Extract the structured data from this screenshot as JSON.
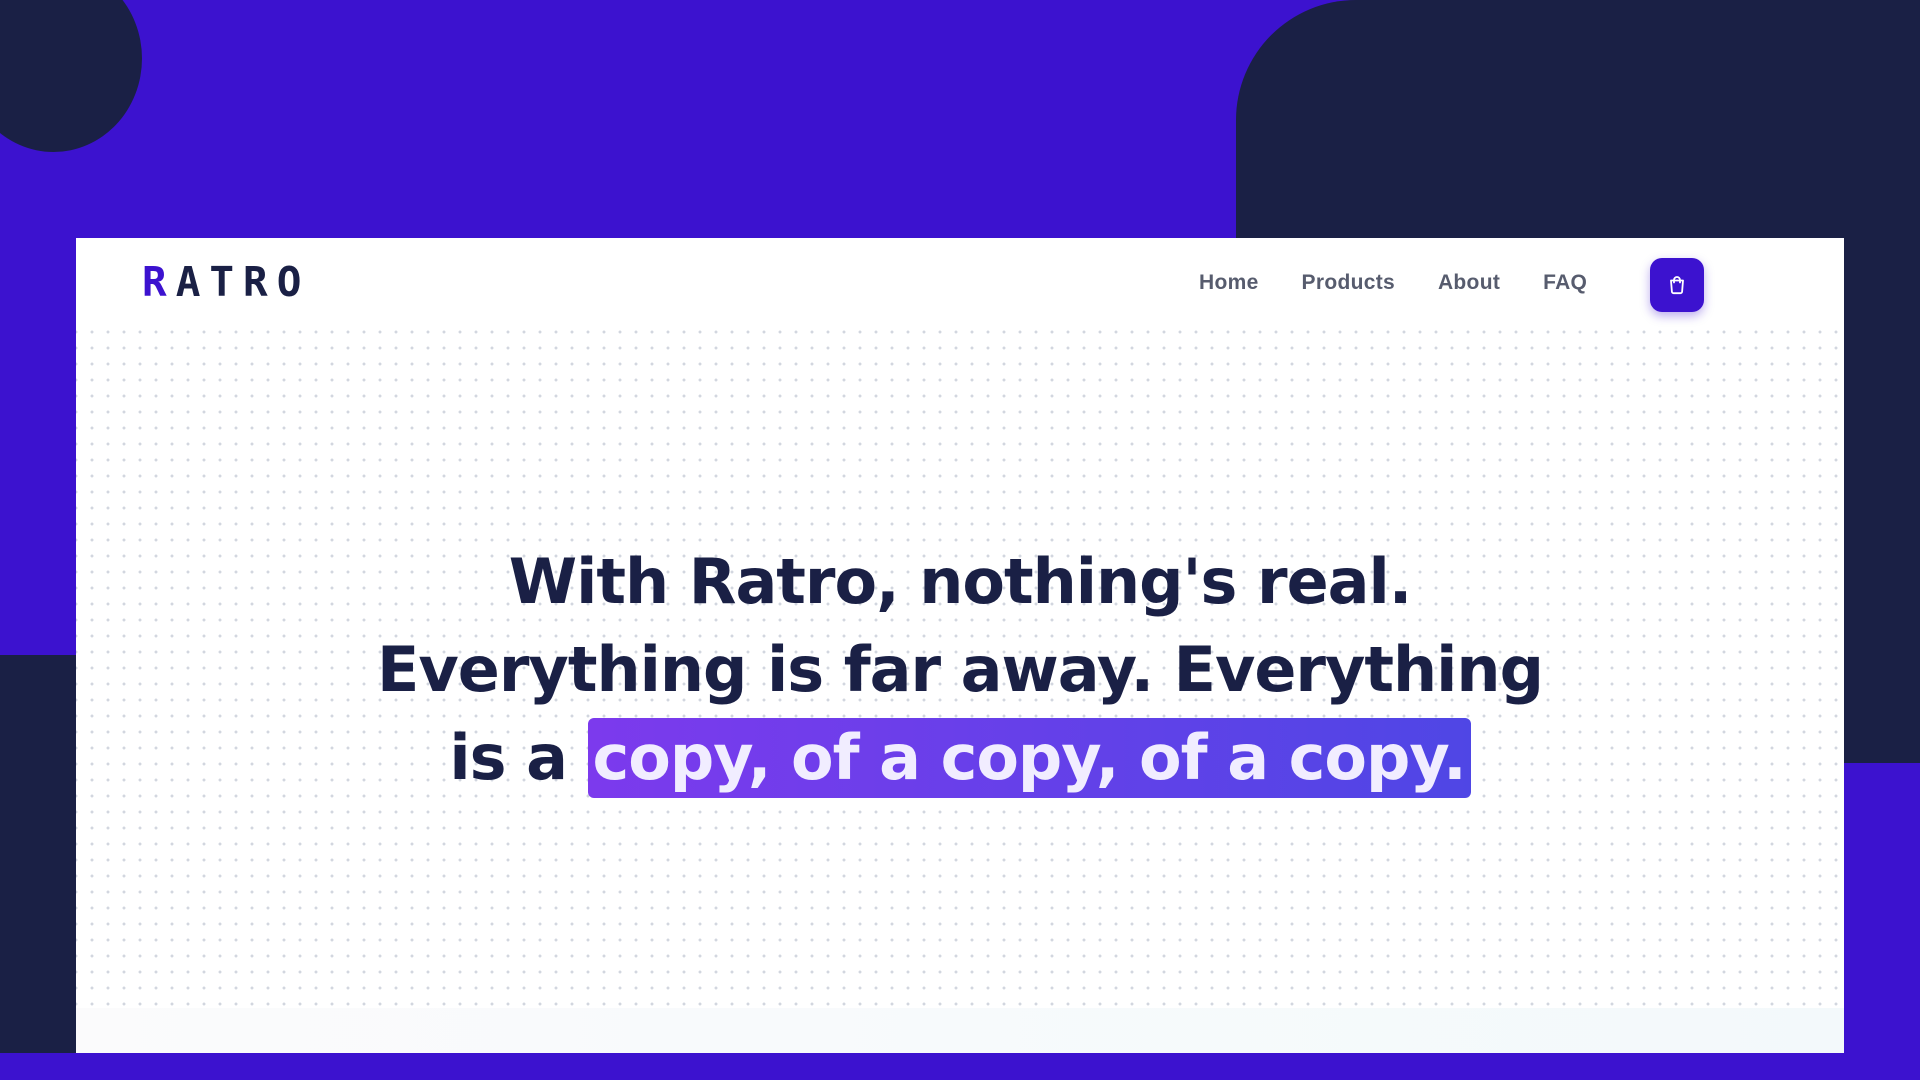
{
  "brand": {
    "logo_first": "R",
    "logo_rest": "ATRO",
    "primary_color": "#3c12cf",
    "dark_color": "#1a2045"
  },
  "nav": {
    "items": [
      {
        "label": "Home"
      },
      {
        "label": "Products"
      },
      {
        "label": "About"
      },
      {
        "label": "FAQ"
      }
    ],
    "cart_icon": "shopping-bag-icon"
  },
  "hero": {
    "line1": "With Ratro, nothing's real.",
    "line2": "Everything is far away. Everything",
    "line3_prefix": "is a",
    "line3_highlight": "copy, of a copy, of a copy.",
    "highlight_gradient": [
      "#7c3aed",
      "#4f46e5"
    ]
  }
}
